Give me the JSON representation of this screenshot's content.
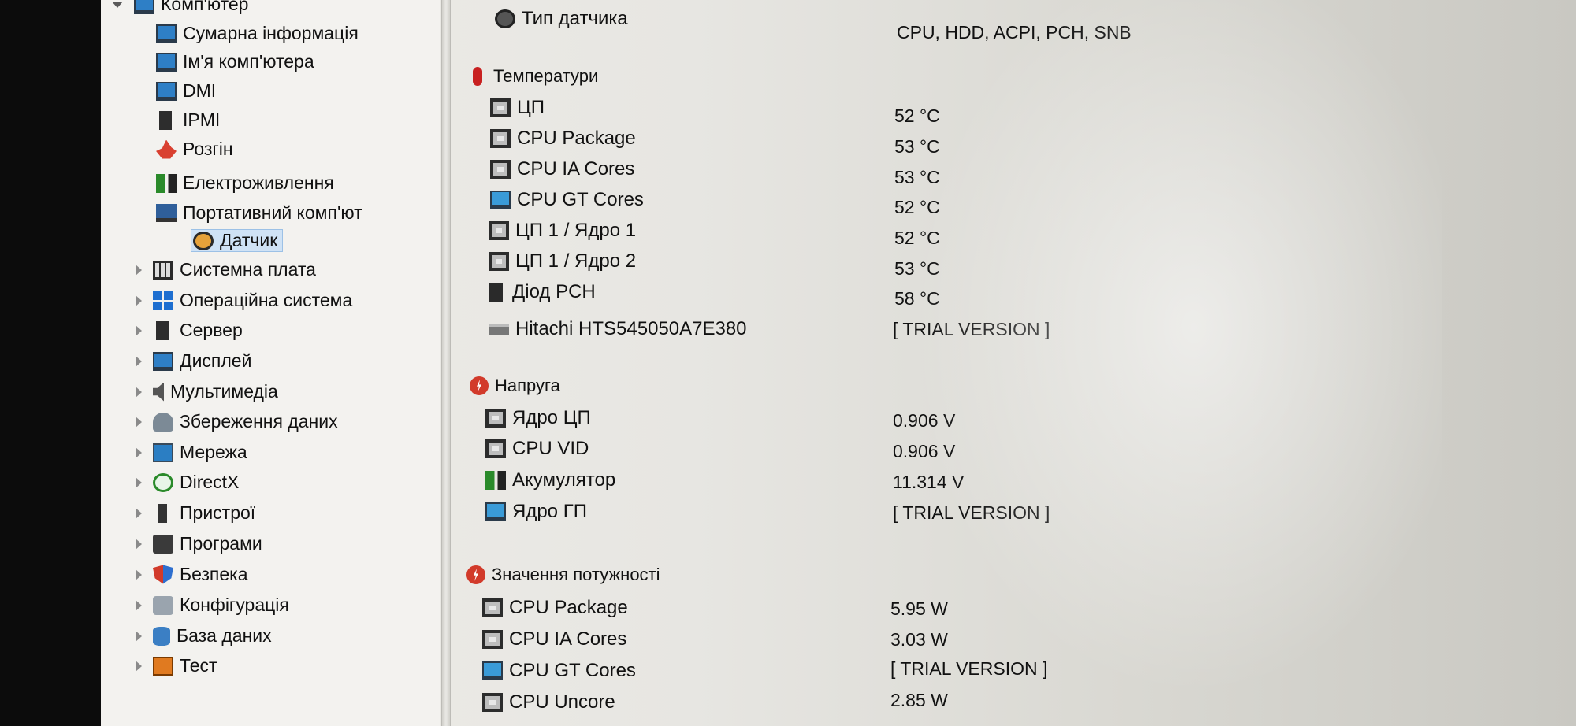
{
  "tree": {
    "root_label": "Комп'ютер",
    "children": [
      {
        "label": "Сумарна інформація",
        "icon": "monitor-icon"
      },
      {
        "label": "Ім'я комп'ютера",
        "icon": "monitor-icon"
      },
      {
        "label": "DMI",
        "icon": "monitor-icon"
      },
      {
        "label": "IPMI",
        "icon": "server-icon"
      },
      {
        "label": "Розгін",
        "icon": "fire-icon"
      },
      {
        "label": "Електроживлення",
        "icon": "battery-icon"
      },
      {
        "label": "Портативний комп'ют",
        "icon": "laptop-icon"
      },
      {
        "label": "Датчик",
        "icon": "sensor-icon",
        "selected": true
      }
    ],
    "categories": [
      {
        "label": "Системна плата",
        "icon": "motherboard-icon"
      },
      {
        "label": "Операційна система",
        "icon": "windows-icon"
      },
      {
        "label": "Сервер",
        "icon": "server-icon"
      },
      {
        "label": "Дисплей",
        "icon": "display-icon"
      },
      {
        "label": "Мультимедіа",
        "icon": "speaker-icon"
      },
      {
        "label": "Збереження даних",
        "icon": "storage-icon"
      },
      {
        "label": "Мережа",
        "icon": "network-icon"
      },
      {
        "label": "DirectX",
        "icon": "xbox-icon"
      },
      {
        "label": "Пристрої",
        "icon": "device-icon"
      },
      {
        "label": "Програми",
        "icon": "programs-icon"
      },
      {
        "label": "Безпека",
        "icon": "shield-icon"
      },
      {
        "label": "Конфігурація",
        "icon": "config-icon"
      },
      {
        "label": "База даних",
        "icon": "database-icon"
      },
      {
        "label": "Тест",
        "icon": "test-icon"
      }
    ]
  },
  "details": {
    "sensor_type": {
      "label": "Тип датчика",
      "value": "CPU, HDD, ACPI, PCH, SNB"
    },
    "temperatures": {
      "title": "Температури",
      "rows": [
        {
          "label": "ЦП",
          "value": "52 °C",
          "icon": "cpu-chip-icon"
        },
        {
          "label": "CPU Package",
          "value": "53 °C",
          "icon": "cpu-chip-icon"
        },
        {
          "label": "CPU IA Cores",
          "value": "53 °C",
          "icon": "cpu-chip-icon"
        },
        {
          "label": "CPU GT Cores",
          "value": "52 °C",
          "icon": "gpu-icon"
        },
        {
          "label": "ЦП 1 / Ядро 1",
          "value": "52 °C",
          "icon": "cpu-chip-icon"
        },
        {
          "label": "ЦП 1 / Ядро 2",
          "value": "53 °C",
          "icon": "cpu-chip-icon"
        },
        {
          "label": "Діод PCH",
          "value": "58 °C",
          "icon": "diode-icon"
        },
        {
          "label": "Hitachi HTS545050A7E380",
          "value": "[ TRIAL VERSION ]",
          "icon": "hdd-icon"
        }
      ]
    },
    "voltage": {
      "title": "Напруга",
      "rows": [
        {
          "label": "Ядро ЦП",
          "value": "0.906 V",
          "icon": "cpu-chip-icon"
        },
        {
          "label": "CPU VID",
          "value": "0.906 V",
          "icon": "cpu-chip-icon"
        },
        {
          "label": "Акумулятор",
          "value": "11.314 V",
          "icon": "battery-icon"
        },
        {
          "label": "Ядро ГП",
          "value": "[ TRIAL VERSION ]",
          "icon": "gpu-icon"
        }
      ]
    },
    "power": {
      "title": "Значення потужності",
      "rows": [
        {
          "label": "CPU Package",
          "value": "5.95 W",
          "icon": "cpu-chip-icon"
        },
        {
          "label": "CPU IA Cores",
          "value": "3.03 W",
          "icon": "cpu-chip-icon"
        },
        {
          "label": "CPU GT Cores",
          "value": "[ TRIAL VERSION ]",
          "icon": "gpu-icon"
        },
        {
          "label": "CPU Uncore",
          "value": "2.85 W",
          "icon": "cpu-chip-icon"
        }
      ]
    }
  }
}
